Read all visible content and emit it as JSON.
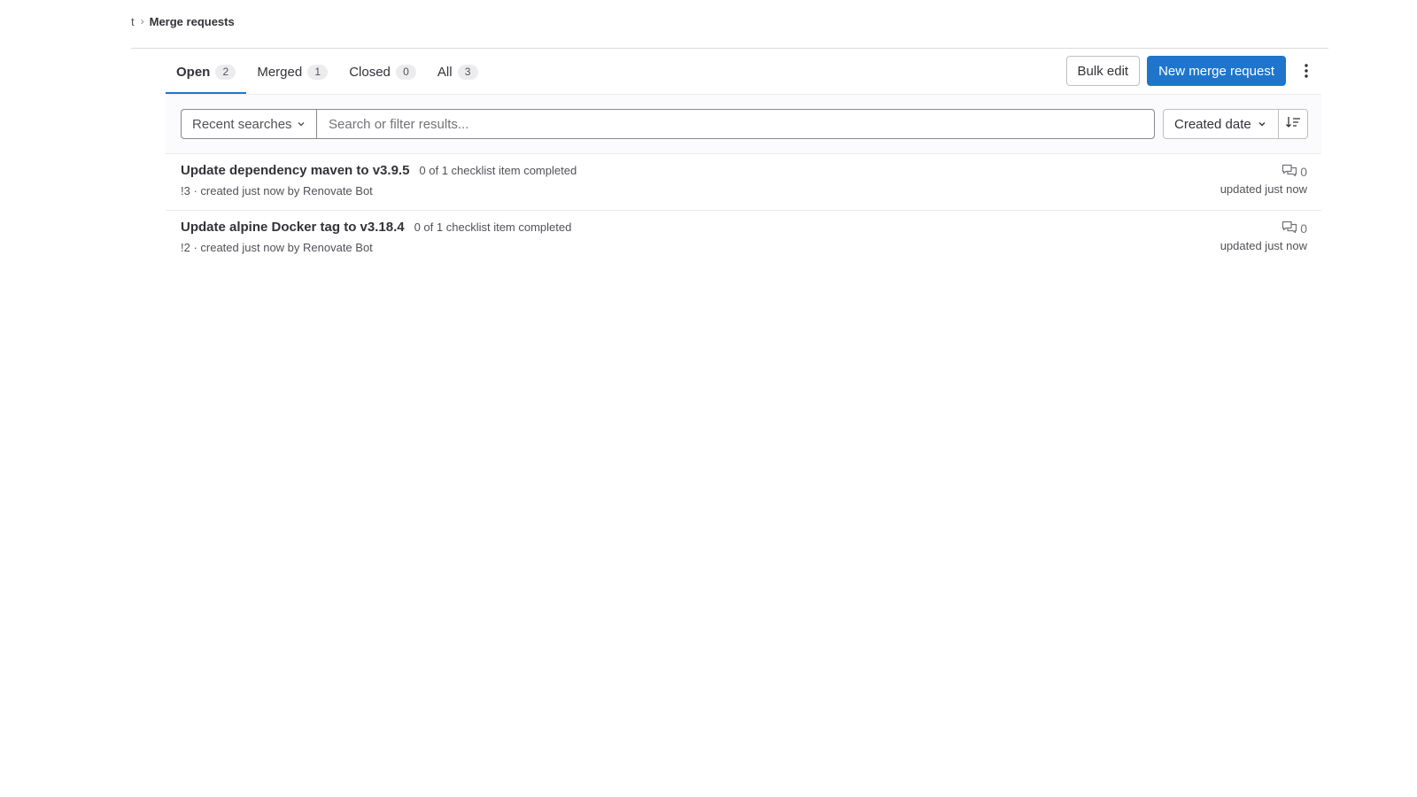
{
  "breadcrumb": {
    "previous": "t",
    "separator": "›",
    "current": "Merge requests"
  },
  "tabs": [
    {
      "label": "Open",
      "count": "2",
      "active": true
    },
    {
      "label": "Merged",
      "count": "1",
      "active": false
    },
    {
      "label": "Closed",
      "count": "0",
      "active": false
    },
    {
      "label": "All",
      "count": "3",
      "active": false
    }
  ],
  "actions": {
    "bulk_edit": "Bulk edit",
    "new_merge_request": "New merge request",
    "more_icon": "ellipsis-vertical-icon"
  },
  "filter": {
    "recent_searches": "Recent searches",
    "search_placeholder": "Search or filter results...",
    "search_value": "",
    "sort_by": "Created date",
    "sort_direction_icon": "sort-lowest-icon"
  },
  "merge_requests": [
    {
      "title": "Update dependency maven to v3.9.5",
      "checklist": "0 of 1 checklist item completed",
      "meta": "!3 · created just now by Renovate Bot",
      "comments": "0",
      "updated": "updated just now"
    },
    {
      "title": "Update alpine Docker tag to v3.18.4",
      "checklist": "0 of 1 checklist item completed",
      "meta": "!2 · created just now by Renovate Bot",
      "comments": "0",
      "updated": "updated just now"
    }
  ],
  "colors": {
    "primary": "#1f75cb",
    "text": "#333238",
    "muted": "#535158",
    "border": "#dcdcde"
  }
}
